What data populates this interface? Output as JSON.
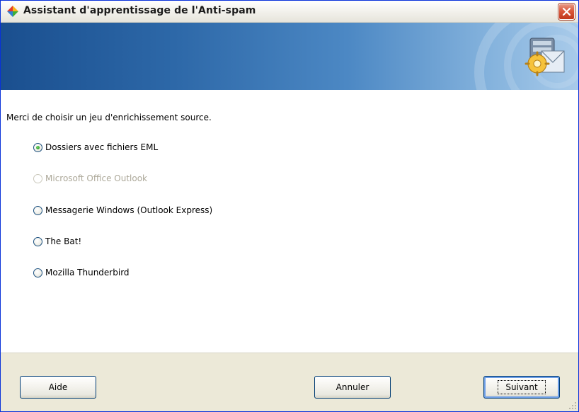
{
  "window": {
    "title": "Assistant d'apprentissage de l'Anti-spam"
  },
  "content": {
    "prompt": "Merci de choisir un jeu d'enrichissement source.",
    "options": [
      {
        "label": "Dossiers avec fichiers EML",
        "selected": true,
        "enabled": true
      },
      {
        "label": "Microsoft Office Outlook",
        "selected": false,
        "enabled": false
      },
      {
        "label": "Messagerie Windows (Outlook Express)",
        "selected": false,
        "enabled": true
      },
      {
        "label": "The Bat!",
        "selected": false,
        "enabled": true
      },
      {
        "label": "Mozilla Thunderbird",
        "selected": false,
        "enabled": true
      }
    ]
  },
  "buttons": {
    "help": "Aide",
    "cancel": "Annuler",
    "next": "Suivant"
  },
  "colors": {
    "banner_dark": "#1a4f8f",
    "banner_light": "#a9cbea",
    "footer": "#ece9d8",
    "radio_selected": "#2d9c25"
  },
  "icons": {
    "app": "avg-logo-icon",
    "banner": "mail-settings-icon",
    "close": "close-icon"
  }
}
